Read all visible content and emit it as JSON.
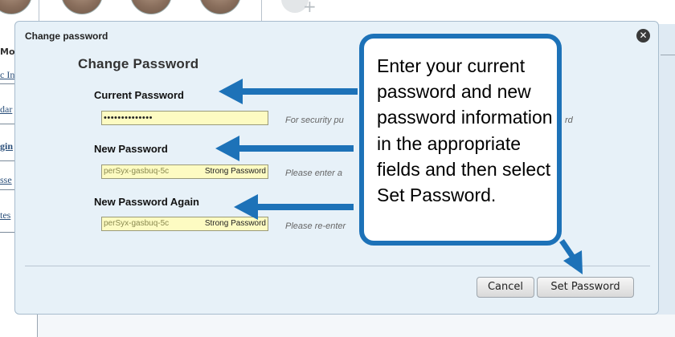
{
  "background": {
    "left_labels": [
      "Mo",
      "c In",
      "dar",
      "gin",
      "sse",
      "tes"
    ]
  },
  "dialog": {
    "title": "Change password",
    "heading": "Change Password",
    "close_icon": "close-icon",
    "fields": [
      {
        "label": "Current Password",
        "value": "••••••••••••••",
        "strength": "",
        "hint": "For security pu"
      },
      {
        "label": "New Password",
        "value": "perSyx-gasbuq-5c",
        "strength": "Strong Password",
        "hint": "Please enter a"
      },
      {
        "label": "New Password Again",
        "value": "perSyx-gasbuq-5c",
        "strength": "Strong Password",
        "hint": "Please re-enter"
      }
    ],
    "hint_tail": "rd",
    "buttons": {
      "cancel": "Cancel",
      "set": "Set Password"
    }
  },
  "callout": {
    "text": "Enter your current password and new password information in the appropriate fields and then select Set Password.",
    "color": "#1d72b8"
  },
  "colors": {
    "accent": "#1d72b8",
    "field_bg": "#fdfbc2",
    "dialog_bg": "#e7f1f8"
  }
}
